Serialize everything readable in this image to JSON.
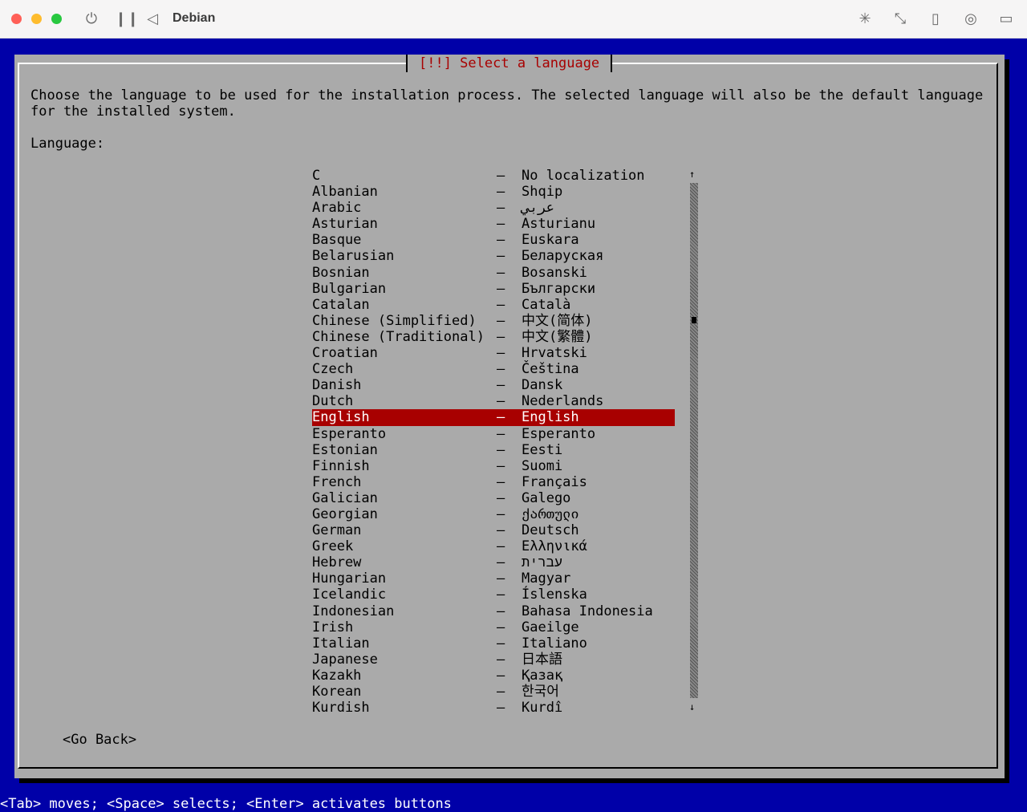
{
  "window": {
    "title": "Debian",
    "icons": [
      "power-icon",
      "pause-icon",
      "back-icon",
      "brightness-icon",
      "resize-icon",
      "usb-icon",
      "network-icon",
      "folder-icon"
    ]
  },
  "dialog": {
    "title": "[!!] Select a language",
    "intro_line1": "Choose the language to be used for the installation process. The selected language will also be the default language",
    "intro_line2": "for the installed system.",
    "language_label": "Language:",
    "languages": [
      {
        "en": "C",
        "nat": "No localization"
      },
      {
        "en": "Albanian",
        "nat": "Shqip"
      },
      {
        "en": "Arabic",
        "nat": "عربي"
      },
      {
        "en": "Asturian",
        "nat": "Asturianu"
      },
      {
        "en": "Basque",
        "nat": "Euskara"
      },
      {
        "en": "Belarusian",
        "nat": "Беларуская"
      },
      {
        "en": "Bosnian",
        "nat": "Bosanski"
      },
      {
        "en": "Bulgarian",
        "nat": "Български"
      },
      {
        "en": "Catalan",
        "nat": "Català"
      },
      {
        "en": "Chinese (Simplified)",
        "nat": "中文(简体)"
      },
      {
        "en": "Chinese (Traditional)",
        "nat": "中文(繁體)"
      },
      {
        "en": "Croatian",
        "nat": "Hrvatski"
      },
      {
        "en": "Czech",
        "nat": "Čeština"
      },
      {
        "en": "Danish",
        "nat": "Dansk"
      },
      {
        "en": "Dutch",
        "nat": "Nederlands"
      },
      {
        "en": "English",
        "nat": "English",
        "selected": true
      },
      {
        "en": "Esperanto",
        "nat": "Esperanto"
      },
      {
        "en": "Estonian",
        "nat": "Eesti"
      },
      {
        "en": "Finnish",
        "nat": "Suomi"
      },
      {
        "en": "French",
        "nat": "Français"
      },
      {
        "en": "Galician",
        "nat": "Galego"
      },
      {
        "en": "Georgian",
        "nat": "ქართული"
      },
      {
        "en": "German",
        "nat": "Deutsch"
      },
      {
        "en": "Greek",
        "nat": "Ελληνικά"
      },
      {
        "en": "Hebrew",
        "nat": "עברית"
      },
      {
        "en": "Hungarian",
        "nat": "Magyar"
      },
      {
        "en": "Icelandic",
        "nat": "Íslenska"
      },
      {
        "en": "Indonesian",
        "nat": "Bahasa Indonesia"
      },
      {
        "en": "Irish",
        "nat": "Gaeilge"
      },
      {
        "en": "Italian",
        "nat": "Italiano"
      },
      {
        "en": "Japanese",
        "nat": "日本語"
      },
      {
        "en": "Kazakh",
        "nat": "Қазақ"
      },
      {
        "en": "Korean",
        "nat": "한국어"
      },
      {
        "en": "Kurdish",
        "nat": "Kurdî"
      }
    ],
    "dash": "–",
    "go_back": "<Go Back>"
  },
  "status_bar": "<Tab> moves; <Space> selects; <Enter> activates buttons",
  "colors": {
    "background": "#0000a8",
    "dialog": "#aaaaaa",
    "accent": "#a80000"
  }
}
